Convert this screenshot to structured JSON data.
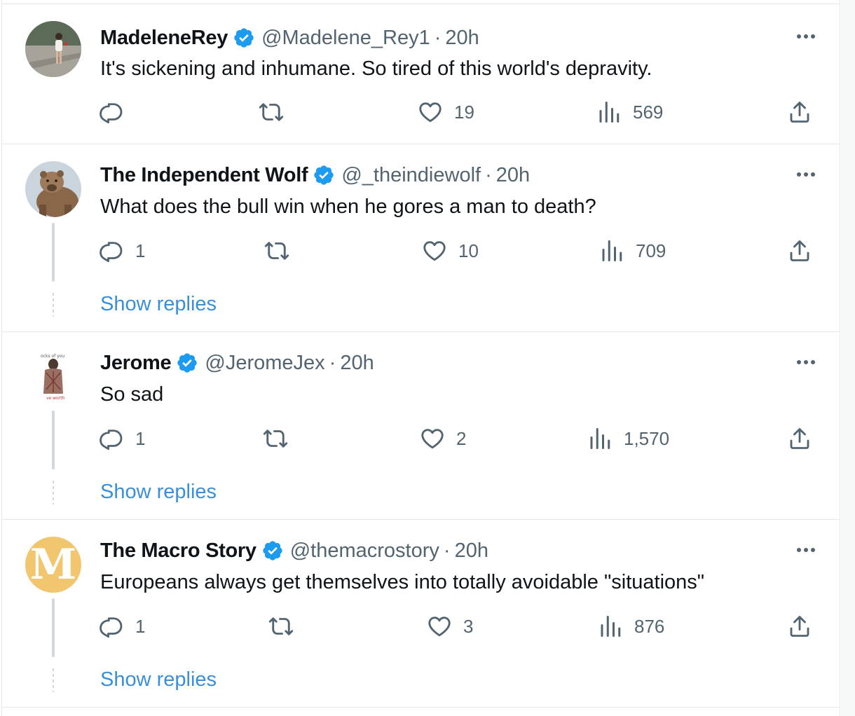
{
  "colors": {
    "verified": "#1d9bf0",
    "link": "#3a8fd6",
    "muted": "#536471",
    "text": "#0f1419",
    "macro_avatar_bg": "#f2c66e"
  },
  "tweets": [
    {
      "name": "MadeleneRey",
      "handle": "@Madelene_Rey1",
      "sep": "·",
      "time": "20h",
      "text": "It's sickening and inhumane. So tired of this world's depravity.",
      "reply_count": "",
      "retweet_count": "",
      "like_count": "19",
      "view_count": "569",
      "show_replies": ""
    },
    {
      "name": "The Independent Wolf",
      "handle": "@_theindiewolf",
      "sep": "·",
      "time": "20h",
      "text": "What does the bull win when he gores a man to death?",
      "reply_count": "1",
      "retweet_count": "",
      "like_count": "10",
      "view_count": "709",
      "show_replies": "Show replies"
    },
    {
      "name": "Jerome",
      "handle": "@JeromeJex",
      "sep": "·",
      "time": "20h",
      "text": "So sad",
      "reply_count": "1",
      "retweet_count": "",
      "like_count": "2",
      "view_count": "1,570",
      "show_replies": "Show replies"
    },
    {
      "name": "The Macro Story",
      "handle": "@themacrostory",
      "sep": "·",
      "time": "20h",
      "text": "Europeans always get themselves into totally avoidable \"situations\"",
      "reply_count": "1",
      "retweet_count": "",
      "like_count": "3",
      "view_count": "876",
      "show_replies": "Show replies",
      "avatar_letter": "M"
    }
  ],
  "icons": {
    "reply": "reply-icon",
    "retweet": "retweet-icon",
    "like": "heart-icon",
    "views": "views-icon",
    "share": "share-icon",
    "more": "more-icon",
    "verified": "verified-badge-icon"
  }
}
